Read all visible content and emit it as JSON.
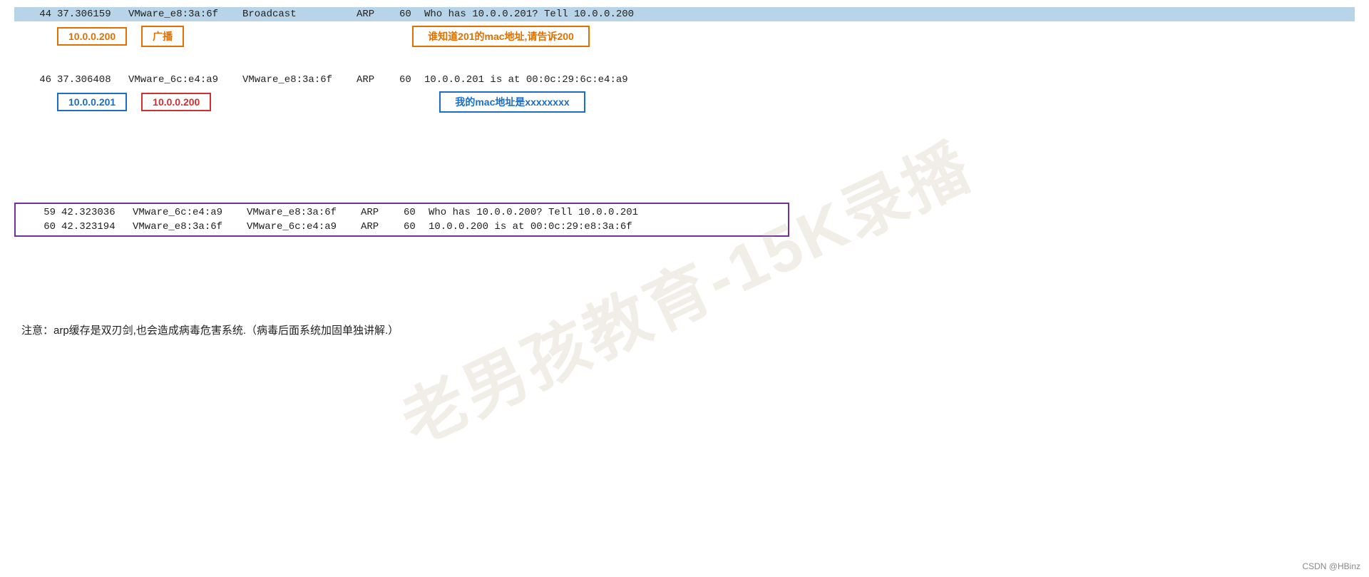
{
  "packets": {
    "row1": {
      "no": "44",
      "time": "37.306159",
      "src": "VMware_e8:3a:6f",
      "dst": "Broadcast",
      "proto": "ARP",
      "len": "60",
      "info": "Who has 10.0.0.201? Tell 10.0.0.200"
    },
    "row1_ann": {
      "src_ip": "10.0.0.200",
      "dst_label": "广播",
      "info_label": "谁知道201的mac地址,请告诉200"
    },
    "row2": {
      "no": "46",
      "time": "37.306408",
      "src": "VMware_6c:e4:a9",
      "dst": "VMware_e8:3a:6f",
      "proto": "ARP",
      "len": "60",
      "info": "10.0.0.201 is at 00:0c:29:6c:e4:a9"
    },
    "row2_ann": {
      "src_ip": "10.0.0.201",
      "dst_ip": "10.0.0.200",
      "info_label": "我的mac地址是xxxxxxxx"
    },
    "row3": {
      "no": "59",
      "time": "42.323036",
      "src": "VMware_6c:e4:a9",
      "dst": "VMware_e8:3a:6f",
      "proto": "ARP",
      "len": "60",
      "info": "Who has 10.0.0.200? Tell 10.0.0.201"
    },
    "row4": {
      "no": "60",
      "time": "42.323194",
      "src": "VMware_e8:3a:6f",
      "dst": "VMware_6c:e4:a9",
      "proto": "ARP",
      "len": "60",
      "info": "10.0.0.200 is at 00:0c:29:e8:3a:6f"
    }
  },
  "note": {
    "text": "注意：arp缓存是双刃剑,也会造成病毒危害系统.（病毒后面系统加固单独讲解.）"
  },
  "watermark": {
    "text": "老男孩教育-15K录播"
  },
  "csdn": {
    "text": "CSDN @HBinz"
  }
}
